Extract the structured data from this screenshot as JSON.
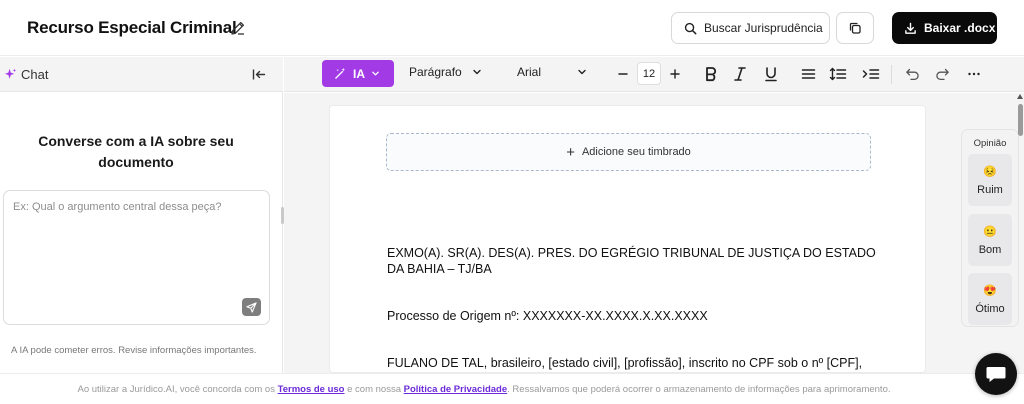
{
  "header": {
    "title": "Recurso Especial Criminal",
    "search_button": "Buscar Jurisprudência",
    "download_button": "Baixar .docx"
  },
  "sidebar": {
    "tab_label": "Chat",
    "heading": "Converse com a IA sobre seu documento",
    "input_placeholder": "Ex: Qual o argumento central dessa peça?",
    "disclaimer": "A IA pode cometer erros. Revise informações importantes."
  },
  "toolbar": {
    "ai_label": "IA",
    "paragraph_style": "Parágrafo",
    "font": "Arial",
    "font_size": "12",
    "icons": [
      "minus-icon",
      "plus-icon",
      "bold-icon",
      "italic-icon",
      "underline-icon",
      "align-icon",
      "line-spacing-icon",
      "indent-icon",
      "undo-icon",
      "redo-icon",
      "more-icon"
    ]
  },
  "document": {
    "letterhead_label": "Adicione seu timbrado",
    "addressee": "EXMO(A). SR(A). DES(A). PRES. DO EGRÉGIO TRIBUNAL DE JUSTIÇA DO ESTADO DA BAHIA – TJ/BA",
    "process": "Processo de Origem nº: XXXXXXX-XX.XXXX.X.XX.XXXX",
    "party": "FULANO DE TAL, brasileiro, [estado civil], [profissão], inscrito no CPF sob o nº [CPF],"
  },
  "feedback": {
    "title": "Opinião",
    "options": [
      {
        "label": "Ruim",
        "emoji": "😣"
      },
      {
        "label": "Bom",
        "emoji": "😐"
      },
      {
        "label": "Ótimo",
        "emoji": "😍"
      }
    ]
  },
  "footer": {
    "text_before": "Ao utilizar a Jurídico.AI, você concorda com os",
    "terms_link": "Termos de uso",
    "text_middle": "e com nossa",
    "privacy_link": "Política de Privacidade",
    "text_after": ". Ressalvamos que poderá ocorrer o armazenamento de informações para aprimoramento."
  },
  "colors": {
    "accent": "#a23be6",
    "primary_button": "#0a0a0a",
    "link": "#6c2bd9"
  }
}
